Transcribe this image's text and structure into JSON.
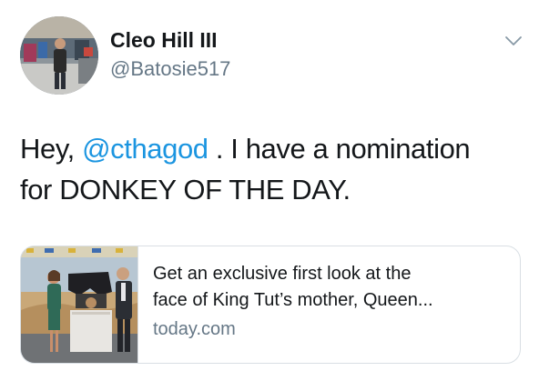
{
  "author": {
    "display_name": "Cleo Hill III",
    "handle": "@Batosie517"
  },
  "menu_icon": "chevron-down-icon",
  "tweet": {
    "prefix": "Hey, ",
    "mention": "@cthagod",
    "line1_suffix": " . I have a nomination",
    "line2": "for DONKEY OF THE DAY."
  },
  "card": {
    "title_line1": "Get an exclusive first look at the",
    "title_line2": "face of King Tut’s mother, Queen...",
    "domain": "today.com"
  },
  "colors": {
    "link": "#1b95e0",
    "text": "#14171a",
    "secondary": "#657786",
    "border": "#d9dfe4"
  }
}
